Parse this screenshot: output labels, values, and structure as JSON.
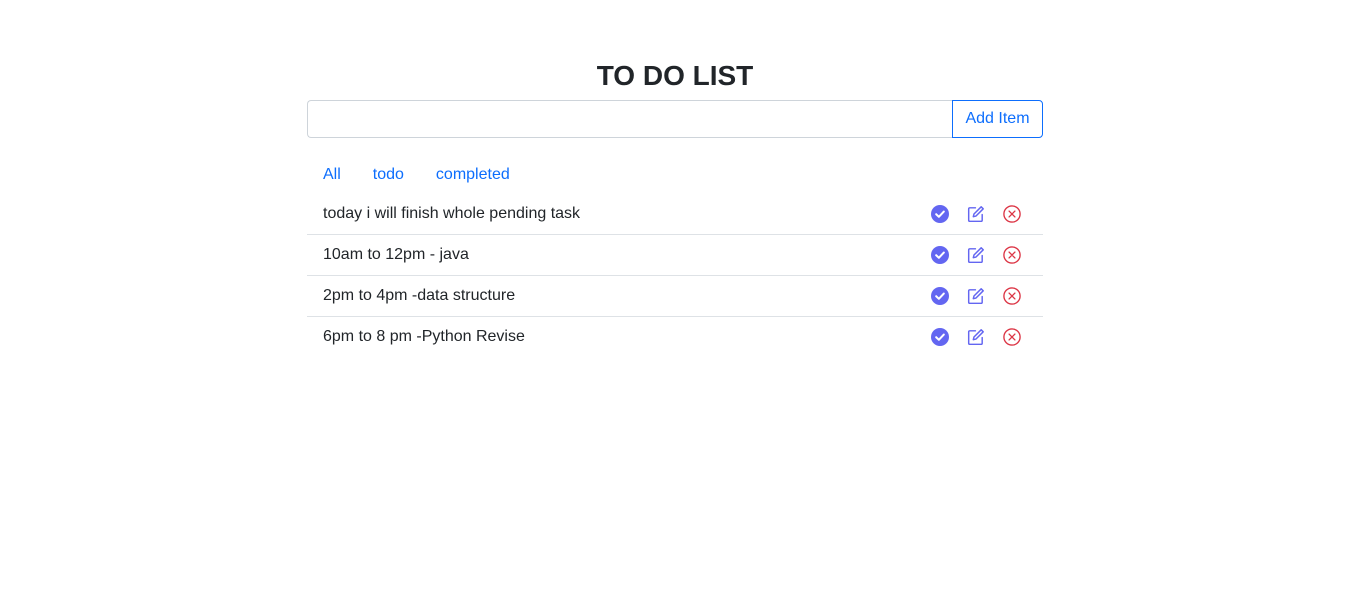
{
  "app": {
    "title": "TO DO LIST"
  },
  "input": {
    "value": "",
    "placeholder": ""
  },
  "add_button": {
    "label": "Add Item"
  },
  "filters": [
    {
      "label": "All"
    },
    {
      "label": "todo"
    },
    {
      "label": "completed"
    }
  ],
  "items": [
    {
      "text": "today i will finish whole pending task"
    },
    {
      "text": "10am to 12pm - java"
    },
    {
      "text": "2pm to 4pm -data structure"
    },
    {
      "text": "6pm to 8 pm -Python Revise"
    }
  ],
  "icons": {
    "complete": "check-circle-icon",
    "edit": "edit-icon",
    "delete": "x-circle-icon"
  },
  "colors": {
    "accent": "#0d6efd",
    "complete_icon": "#6366f1",
    "edit_icon": "#6366f1",
    "delete_icon": "#dc3545",
    "divider": "#dee2e6"
  }
}
